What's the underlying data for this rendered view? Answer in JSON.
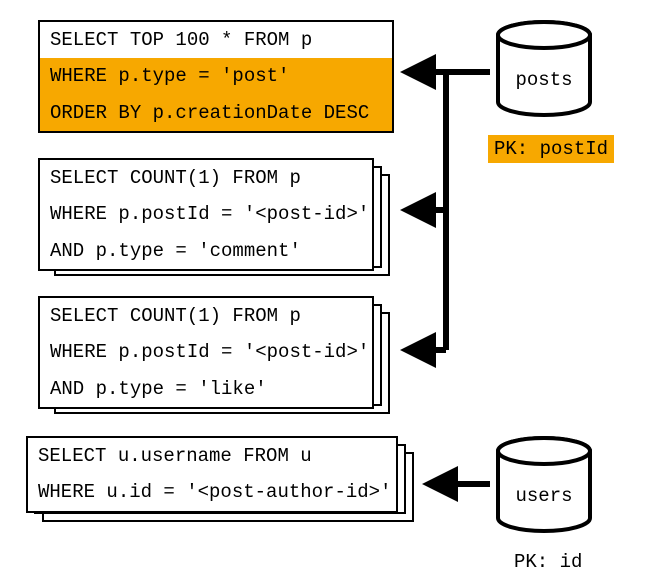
{
  "query1": {
    "line1": "SELECT TOP 100 * FROM p",
    "line2": "WHERE p.type = 'post'",
    "line3": "ORDER BY p.creationDate DESC"
  },
  "query2": {
    "line1": "SELECT COUNT(1) FROM p",
    "line2": "WHERE p.postId = '<post-id>'",
    "line3": "AND p.type = 'comment'"
  },
  "query3": {
    "line1": "SELECT COUNT(1) FROM p",
    "line2": "WHERE p.postId = '<post-id>'",
    "line3": "AND p.type = 'like'"
  },
  "query4": {
    "line1": "SELECT u.username FROM u",
    "line2": "WHERE u.id = '<post-author-id>'"
  },
  "db1": {
    "name": "posts",
    "pk": "PK: postId"
  },
  "db2": {
    "name": "users",
    "pk": "PK: id"
  },
  "colors": {
    "highlight": "#f7a800"
  }
}
